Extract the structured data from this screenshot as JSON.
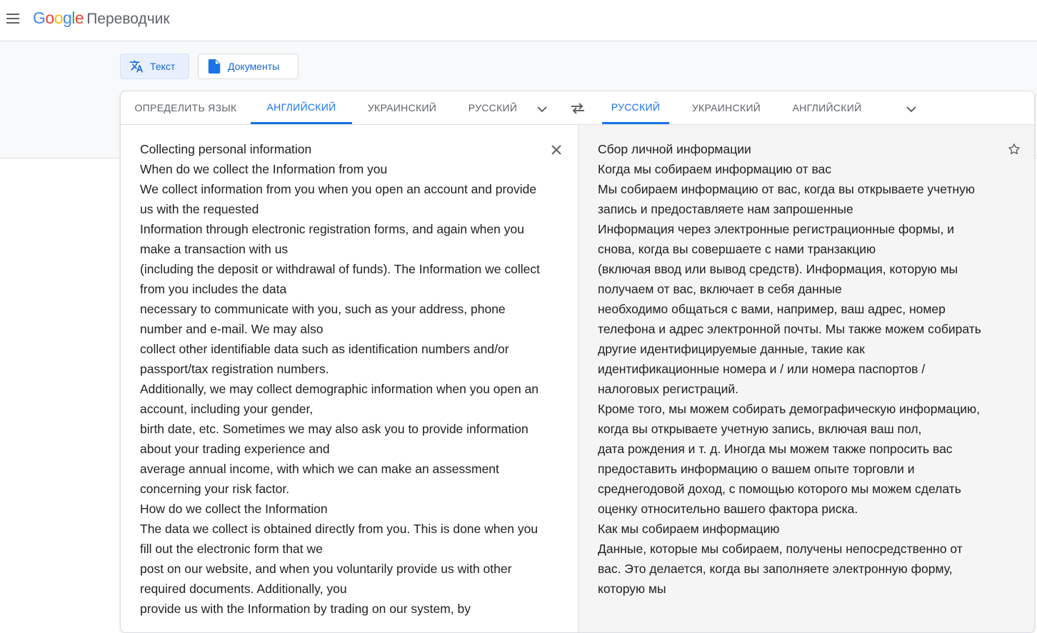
{
  "app": {
    "logo_letters": [
      "G",
      "o",
      "o",
      "g",
      "l",
      "e"
    ],
    "product_name": "Переводчик"
  },
  "modes": {
    "text_label": "Текст",
    "documents_label": "Документы"
  },
  "source_langs": {
    "detect": "ОПРЕДЕЛИТЬ ЯЗЫК",
    "tab1": "АНГЛИЙСКИЙ",
    "tab2": "УКРАИНСКИЙ",
    "tab3": "РУССКИЙ",
    "selected": "АНГЛИЙСКИЙ"
  },
  "target_langs": {
    "tab1": "РУССКИЙ",
    "tab2": "УКРАИНСКИЙ",
    "tab3": "АНГЛИЙСКИЙ",
    "selected": "РУССКИЙ"
  },
  "icons": {
    "menu": "menu-icon",
    "translate": "translate-icon",
    "document": "document-icon",
    "swap": "swap-icon",
    "expand": "chevron-down-icon",
    "clear": "close-icon",
    "save": "star-icon"
  },
  "colors": {
    "accent": "#1a73e8",
    "target_bg": "#f5f5f5",
    "band_bg": "#f8f9fa"
  },
  "source_text": "Collecting personal information\nWhen do we collect the Information from you\nWe collect information from you when you open an account and provide us with the requested\nInformation through electronic registration forms, and again when you make a transaction with us\n(including the deposit or withdrawal of funds). The Information we collect from you includes the data\nnecessary to communicate with you, such as your address, phone number and e-mail. We may also\ncollect other identifiable data such as identification numbers and/or passport/tax registration numbers.\nAdditionally, we may collect demographic information when you open an account, including your gender,\nbirth date, etc. Sometimes we may also ask you to provide information about your trading experience and\naverage annual income, with which we can make an assessment concerning your risk factor.\nHow do we collect the Information\nThe data we collect is obtained directly from you. This is done when you fill out the electronic form that we\npost on our website, and when you voluntarily provide us with other required documents. Additionally, you\nprovide us with the Information by trading on our system, by",
  "translated_text": "Сбор личной информации\nКогда мы собираем информацию от вас\nМы собираем информацию от вас, когда вы открываете учетную запись и предоставляете нам запрошенные\nИнформация через электронные регистрационные формы, и снова, когда вы совершаете с нами транзакцию\n(включая ввод или вывод средств). Информация, которую мы получаем от вас, включает в себя данные\nнеобходимо общаться с вами, например, ваш адрес, номер телефона и адрес электронной почты. Мы также можем собирать другие идентифицируемые данные, такие как идентификационные номера и / или номера паспортов / налоговых регистраций.\nКроме того, мы можем собирать демографическую информацию, когда вы открываете учетную запись, включая ваш пол,\nдата рождения и т. д. Иногда мы можем также попросить вас предоставить информацию о вашем опыте торговли и среднегодовой доход, с помощью которого мы можем сделать оценку относительно вашего фактора риска.\nКак мы собираем информацию\nДанные, которые мы собираем, получены непосредственно от вас. Это делается, когда вы заполняете электронную форму, которую мы"
}
